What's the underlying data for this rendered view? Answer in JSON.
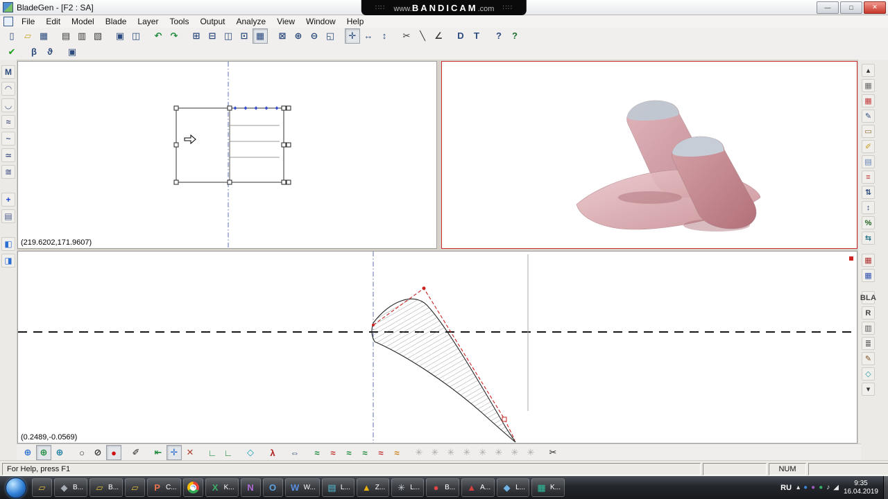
{
  "window": {
    "title": "BladeGen - [F2 : SA]",
    "controls": {
      "minimize": "—",
      "maximize": "□",
      "close": "✕"
    }
  },
  "watermark": {
    "prefix": "www.",
    "brand": "BANDICAM",
    "suffix": ".com",
    "dots": "∷∷"
  },
  "menu": {
    "items": [
      "File",
      "Edit",
      "Model",
      "Blade",
      "Layer",
      "Tools",
      "Output",
      "Analyze",
      "View",
      "Window",
      "Help"
    ]
  },
  "toolbar_main": {
    "icons": [
      {
        "name": "new-file-icon",
        "glyph": "▯",
        "color": "#2b4a7d"
      },
      {
        "name": "open-file-icon",
        "glyph": "▱",
        "color": "#c9a227"
      },
      {
        "name": "save-icon",
        "glyph": "▦",
        "color": "#2b4a7d"
      },
      {
        "name": "print-icon",
        "glyph": "▤",
        "color": "#3a3a3a",
        "gap": "true"
      },
      {
        "name": "print-preview-icon",
        "glyph": "▥",
        "color": "#3a3a3a"
      },
      {
        "name": "page-setup-icon",
        "glyph": "▧",
        "color": "#3a3a3a"
      },
      {
        "name": "copy-icon",
        "glyph": "▣",
        "color": "#2b4a7d",
        "gap": "true"
      },
      {
        "name": "paste-icon",
        "glyph": "◫",
        "color": "#2b4a7d"
      },
      {
        "name": "undo-icon",
        "glyph": "↶",
        "color": "#1d8a3c",
        "gap": "true"
      },
      {
        "name": "redo-icon",
        "glyph": "↷",
        "color": "#1d8a3c"
      },
      {
        "name": "split-quad-icon",
        "glyph": "⊞",
        "color": "#2b4a7d",
        "gap": "true"
      },
      {
        "name": "split-horizontal-icon",
        "glyph": "⊟",
        "color": "#2b4a7d"
      },
      {
        "name": "split-vertical-icon",
        "glyph": "◫",
        "color": "#2b4a7d"
      },
      {
        "name": "single-view-icon",
        "glyph": "⊡",
        "color": "#2b4a7d"
      },
      {
        "name": "worksheet-icon",
        "glyph": "▦",
        "color": "#2b4a7d",
        "pressed": "true"
      },
      {
        "name": "fit-view-icon",
        "glyph": "⊠",
        "color": "#2b4a7d",
        "gap": "true"
      },
      {
        "name": "zoom-in-icon",
        "glyph": "⊕",
        "color": "#2b4a7d"
      },
      {
        "name": "zoom-out-icon",
        "glyph": "⊖",
        "color": "#2b4a7d"
      },
      {
        "name": "zoom-window-icon",
        "glyph": "◱",
        "color": "#2b4a7d"
      },
      {
        "name": "pan-icon",
        "glyph": "✛",
        "color": "#2b4a7d",
        "gap": "true",
        "pressed": "true"
      },
      {
        "name": "stretch-horizontal-icon",
        "glyph": "↔",
        "color": "#2b4a7d"
      },
      {
        "name": "stretch-vertical-icon",
        "glyph": "↕",
        "color": "#2b4a7d"
      },
      {
        "name": "cut-section-icon",
        "glyph": "✂",
        "color": "#333333",
        "gap": "true"
      },
      {
        "name": "line-tool-icon",
        "glyph": "╲",
        "color": "#333333"
      },
      {
        "name": "angle-tool-icon",
        "glyph": "∠",
        "color": "#333333"
      },
      {
        "name": "data-output-icon",
        "glyph": "D",
        "color": "#2b4a7d",
        "gap": "true"
      },
      {
        "name": "text-output-icon",
        "glyph": "T",
        "color": "#2b4a7d"
      },
      {
        "name": "help-select-icon",
        "glyph": "?",
        "color": "#2b4a7d",
        "gap": "true"
      },
      {
        "name": "help-icon",
        "glyph": "?",
        "color": "#1d6f2f"
      }
    ]
  },
  "toolbar_secondary": {
    "icons": [
      {
        "name": "accept-icon",
        "glyph": "✔",
        "color": "#18a018"
      },
      {
        "name": "beta-definition-icon",
        "glyph": "β",
        "color": "#2b4a7d",
        "gap": "true"
      },
      {
        "name": "theta-definition-icon",
        "glyph": "ϑ",
        "color": "#2b4a7d"
      },
      {
        "name": "properties-icon",
        "glyph": "▣",
        "color": "#2b4a7d",
        "gap": "true"
      }
    ]
  },
  "left_toolbar": {
    "icons": [
      {
        "name": "model-tree-icon",
        "glyph": "M",
        "color": "#2b4a7d"
      },
      {
        "name": "profile-curve-icon",
        "glyph": "◠",
        "color": "#4a5a8a"
      },
      {
        "name": "camber-curve-icon",
        "glyph": "◡",
        "color": "#4a5a8a"
      },
      {
        "name": "thickness-curve-icon",
        "glyph": "≈",
        "color": "#4a5a8a"
      },
      {
        "name": "angle-curve-icon",
        "glyph": "~",
        "color": "#4a5a8a"
      },
      {
        "name": "smooth-curve-icon",
        "glyph": "≃",
        "color": "#4a5a8a"
      },
      {
        "name": "wave-curve-icon",
        "glyph": "≅",
        "color": "#4a5a8a"
      },
      {
        "name": "add-layer-icon",
        "glyph": "+",
        "color": "#2244cc",
        "gap": "true"
      },
      {
        "name": "layer-list-icon",
        "glyph": "▤",
        "color": "#4a5a8a"
      },
      {
        "name": "flip-view-icon",
        "glyph": "◧",
        "color": "#2b6fd4",
        "gap": "true"
      },
      {
        "name": "export-view-icon",
        "glyph": "◨",
        "color": "#2b6fd4"
      }
    ]
  },
  "right_toolbar": {
    "icons": [
      {
        "name": "scroll-up-icon",
        "glyph": "▴",
        "color": "#333333"
      },
      {
        "name": "table-icon",
        "glyph": "▦",
        "color": "#6a6a6a"
      },
      {
        "name": "palette-icon",
        "glyph": "▦",
        "color": "#c23a3a"
      },
      {
        "name": "edit-pencil-icon",
        "glyph": "✎",
        "color": "#2b4a7d"
      },
      {
        "name": "ruler-icon",
        "glyph": "▭",
        "color": "#8a6b2f"
      },
      {
        "name": "marker-pencil-icon",
        "glyph": "✐",
        "color": "#c79a1e"
      },
      {
        "name": "mesh-icon",
        "glyph": "▤",
        "color": "#5b7fae"
      },
      {
        "name": "matrix-icon",
        "glyph": "≡",
        "color": "#c03030"
      },
      {
        "name": "z-updown-icon",
        "glyph": "⇅",
        "color": "#2b4a7d"
      },
      {
        "name": "z-range-icon",
        "glyph": "↕",
        "color": "#2b4a7d"
      },
      {
        "name": "percent-icon",
        "glyph": "%",
        "color": "#206020"
      },
      {
        "name": "swap-icon",
        "glyph": "⇆",
        "color": "#20708a"
      },
      {
        "name": "calculator-red-icon",
        "glyph": "▦",
        "color": "#b03030",
        "gap": "true"
      },
      {
        "name": "calculator-blue-icon",
        "glyph": "▦",
        "color": "#3050b0"
      },
      {
        "name": "blade-label-icon",
        "glyph": "BLA",
        "color": "#444444",
        "gap": "true",
        "small": "true"
      },
      {
        "name": "r-label-icon",
        "glyph": "R",
        "color": "#444444",
        "small": "true"
      },
      {
        "name": "report-grid-icon",
        "glyph": "▥",
        "color": "#555555"
      },
      {
        "name": "list-icon",
        "glyph": "≣",
        "color": "#555555"
      },
      {
        "name": "pen-icon",
        "glyph": "✎",
        "color": "#7a4a1e"
      },
      {
        "name": "diamond-icon",
        "glyph": "◇",
        "color": "#1f9aa0"
      },
      {
        "name": "scroll-down-icon",
        "glyph": "▾",
        "color": "#333333"
      }
    ]
  },
  "bottom_toolbar": {
    "icons": [
      {
        "name": "orbit-view-icon",
        "glyph": "⊕",
        "color": "#2b6fd4"
      },
      {
        "name": "orbit-view-green-icon",
        "glyph": "⊕",
        "color": "#1d8a3c",
        "pressed": "true"
      },
      {
        "name": "orbit-view-teal-icon",
        "glyph": "⊕",
        "color": "#1d7fa0"
      },
      {
        "name": "circle-view-icon",
        "glyph": "○",
        "color": "#333333",
        "gap": "true"
      },
      {
        "name": "section-circle-icon",
        "glyph": "⊘",
        "color": "#333333"
      },
      {
        "name": "active-point-icon",
        "glyph": "●",
        "color": "#cc1111",
        "pressed": "true"
      },
      {
        "name": "draw-pen-icon",
        "glyph": "✐",
        "color": "#222222",
        "gap": "true"
      },
      {
        "name": "jump-start-icon",
        "glyph": "⇤",
        "color": "#1d8a3c",
        "gap": "true"
      },
      {
        "name": "crosshair-icon",
        "glyph": "✛",
        "color": "#2b6fd4",
        "pressed": "true"
      },
      {
        "name": "edit-points-icon",
        "glyph": "✕",
        "color": "#b04030"
      },
      {
        "name": "tangent-left-icon",
        "glyph": "∟",
        "color": "#1d8a3c",
        "gap": "true"
      },
      {
        "name": "tangent-right-icon",
        "glyph": "∟",
        "color": "#1d8a3c"
      },
      {
        "name": "kite-icon",
        "glyph": "◇",
        "color": "#17a2b8",
        "gap": "true"
      },
      {
        "name": "lambda-icon",
        "glyph": "λ",
        "color": "#b02020",
        "gap": "true"
      },
      {
        "name": "span-fit-icon",
        "glyph": "⇔",
        "color": "#2b4a7d",
        "gap": "true"
      },
      {
        "name": "curve-edit-icon",
        "glyph": "≈",
        "color": "#1d8a3c",
        "gap": "true"
      },
      {
        "name": "curve-edit-icon",
        "glyph": "≈",
        "color": "#c03030"
      },
      {
        "name": "curve-edit-icon",
        "glyph": "≈",
        "color": "#1d8a3c"
      },
      {
        "name": "curve-edit-icon",
        "glyph": "≈",
        "color": "#1d8a3c"
      },
      {
        "name": "curve-edit-icon",
        "glyph": "≈",
        "color": "#c03030"
      },
      {
        "name": "curve-edit-icon",
        "glyph": "≈",
        "color": "#d08020"
      },
      {
        "name": "disabled-tool-icon",
        "glyph": "✳",
        "color": "#a9a9a9",
        "gap": "true"
      },
      {
        "name": "disabled-tool-icon",
        "glyph": "✳",
        "color": "#a9a9a9"
      },
      {
        "name": "disabled-tool-icon",
        "glyph": "✳",
        "color": "#a9a9a9"
      },
      {
        "name": "disabled-tool-icon",
        "glyph": "✳",
        "color": "#a9a9a9"
      },
      {
        "name": "disabled-tool-icon",
        "glyph": "✳",
        "color": "#a9a9a9"
      },
      {
        "name": "disabled-tool-icon",
        "glyph": "✳",
        "color": "#a9a9a9"
      },
      {
        "name": "disabled-tool-icon",
        "glyph": "✳",
        "color": "#a9a9a9"
      },
      {
        "name": "disabled-tool-icon",
        "glyph": "✳",
        "color": "#a9a9a9"
      },
      {
        "name": "cut-profile-icon",
        "glyph": "✂",
        "color": "#222222",
        "gap": "true"
      }
    ]
  },
  "panes": {
    "sketch": {
      "coords": "(219.6202,171.9607)"
    },
    "profile": {
      "coords": "(0.2489,-0.0569)"
    }
  },
  "statusbar": {
    "help": "For Help, press F1",
    "num": "NUM"
  },
  "taskbar": {
    "items": [
      {
        "name": "taskbar-folder-1",
        "glyph": "▱",
        "color": "#e3b93f",
        "label": ""
      },
      {
        "name": "taskbar-cad-part",
        "glyph": "◆",
        "color": "#a7adb5",
        "label": "B..."
      },
      {
        "name": "taskbar-folder-2",
        "glyph": "▱",
        "color": "#e3b93f",
        "label": "B..."
      },
      {
        "name": "taskbar-folder-3",
        "glyph": "▱",
        "color": "#e3b93f",
        "label": ""
      },
      {
        "name": "taskbar-powerpoint",
        "glyph": "P",
        "color": "#e8734d",
        "label": "C..."
      },
      {
        "name": "taskbar-chrome",
        "glyph": "●",
        "color": "#ffffff",
        "label": "",
        "kind": "chrome"
      },
      {
        "name": "taskbar-excel",
        "glyph": "X",
        "color": "#3fae6a",
        "label": "K..."
      },
      {
        "name": "taskbar-onenote",
        "glyph": "N",
        "color": "#b06ad4",
        "label": ""
      },
      {
        "name": "taskbar-outlook",
        "glyph": "O",
        "color": "#5aa2e0",
        "label": ""
      },
      {
        "name": "taskbar-word",
        "glyph": "W",
        "color": "#5a8fe0",
        "label": "W..."
      },
      {
        "name": "taskbar-editor",
        "glyph": "▤",
        "color": "#57c0d8",
        "label": "L..."
      },
      {
        "name": "taskbar-aimp",
        "glyph": "▲",
        "color": "#e8b10f",
        "label": "Z..."
      },
      {
        "name": "taskbar-tools",
        "glyph": "✳",
        "color": "#c9ced6",
        "label": "L..."
      },
      {
        "name": "taskbar-bandicam",
        "glyph": "●",
        "color": "#e04545",
        "label": "B..."
      },
      {
        "name": "taskbar-graphics",
        "glyph": "▲",
        "color": "#d43f3f",
        "label": "A..."
      },
      {
        "name": "taskbar-bladegen",
        "glyph": "◆",
        "color": "#6fb3e8",
        "label": "L..."
      },
      {
        "name": "taskbar-misc",
        "glyph": "▦",
        "color": "#2fbf9f",
        "label": "K..."
      }
    ],
    "tray": {
      "lang": "RU",
      "icons": [
        {
          "name": "tray-up-arrow-icon",
          "glyph": "▴",
          "color": "#e8e8e8"
        },
        {
          "name": "tray-app-blue-icon",
          "glyph": "●",
          "color": "#3b82d0"
        },
        {
          "name": "tray-app-purple-icon",
          "glyph": "●",
          "color": "#9a5ab8"
        },
        {
          "name": "tray-app-green-icon",
          "glyph": "●",
          "color": "#35b060"
        },
        {
          "name": "tray-volume-icon",
          "glyph": "♪",
          "color": "#e8e8e8"
        },
        {
          "name": "tray-network-icon",
          "glyph": "◢",
          "color": "#e8e8e8"
        }
      ],
      "time": "9:35",
      "date": "16.04.2019"
    }
  }
}
